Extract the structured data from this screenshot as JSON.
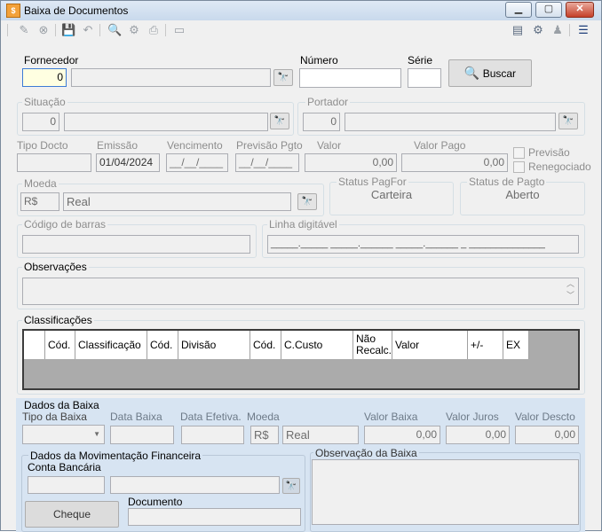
{
  "window": {
    "title": "Baixa de Documentos",
    "icon": "app-icon",
    "minimize": "minimize-icon",
    "maximize": "maximize-icon",
    "close": "close-icon"
  },
  "toolbar": {
    "items": [
      "edit-icon",
      "cancel-icon",
      "save-icon",
      "undo-icon",
      "search-icon",
      "filter-icon",
      "print-icon",
      "monitor-icon"
    ],
    "right": [
      "card-icon",
      "config-icon",
      "user-icon",
      "layout-icon"
    ]
  },
  "fornecedor": {
    "label": "Fornecedor",
    "code": "0",
    "name": ""
  },
  "numero": {
    "label": "Número",
    "value": ""
  },
  "serie": {
    "label": "Série",
    "value": ""
  },
  "buscar": {
    "label": "Buscar"
  },
  "situacao": {
    "label": "Situação",
    "code": "0",
    "name": ""
  },
  "portador": {
    "label": "Portador",
    "code": "0",
    "name": ""
  },
  "tipo_docto": {
    "label": "Tipo Docto",
    "value": ""
  },
  "emissao": {
    "label": "Emissão",
    "value": "01/04/2024"
  },
  "vencimento": {
    "label": "Vencimento",
    "value": "__/__/____"
  },
  "previsao_pgto": {
    "label": "Previsão Pgto",
    "value": "__/__/____"
  },
  "valor": {
    "label": "Valor",
    "value": "0,00"
  },
  "valor_pago": {
    "label": "Valor Pago",
    "value": "0,00"
  },
  "previsao_chk": {
    "label": "Previsão"
  },
  "renegociado_chk": {
    "label": "Renegociado"
  },
  "moeda": {
    "label": "Moeda",
    "symbol": "R$",
    "name": "Real"
  },
  "status_pagfor": {
    "label": "Status PagFor",
    "value": "Carteira"
  },
  "status_pagto": {
    "label": "Status de Pagto",
    "value": "Aberto"
  },
  "codigo_barras": {
    "label": "Código de barras",
    "value": ""
  },
  "linha_digitavel": {
    "label": "Linha digitável",
    "value": "_____._____ _____.______ _____.______ _ ______________"
  },
  "observacoes": {
    "label": "Observações",
    "value": ""
  },
  "classificacoes": {
    "label": "Classificações",
    "columns": [
      "",
      "Cód.",
      "Classificação",
      "Cód.",
      "Divisão",
      "Cód.",
      "C.Custo",
      "Não Recalc.",
      "Valor",
      "+/-",
      "EX"
    ],
    "rows": []
  },
  "dados_baixa": {
    "label": "Dados da Baixa",
    "tipo_baixa": {
      "label": "Tipo da Baixa",
      "value": ""
    },
    "data_baixa": {
      "label": "Data Baixa",
      "value": ""
    },
    "data_efetiva": {
      "label": "Data Efetiva.",
      "value": ""
    },
    "moeda": {
      "label": "Moeda",
      "symbol": "R$",
      "name": "Real"
    },
    "valor_baixa": {
      "label": "Valor Baixa",
      "value": "0,00"
    },
    "valor_juros": {
      "label": "Valor Juros",
      "value": "0,00"
    },
    "valor_descto": {
      "label": "Valor Descto",
      "value": "0,00"
    }
  },
  "mov_financeira": {
    "label": "Dados da Movimentação Financeira",
    "conta_label": "Conta Bancária",
    "conta_code": "",
    "conta_name": "",
    "cheque": "Cheque",
    "documento_label": "Documento",
    "documento": ""
  },
  "obs_baixa": {
    "label": "Observação da Baixa",
    "value": ""
  }
}
